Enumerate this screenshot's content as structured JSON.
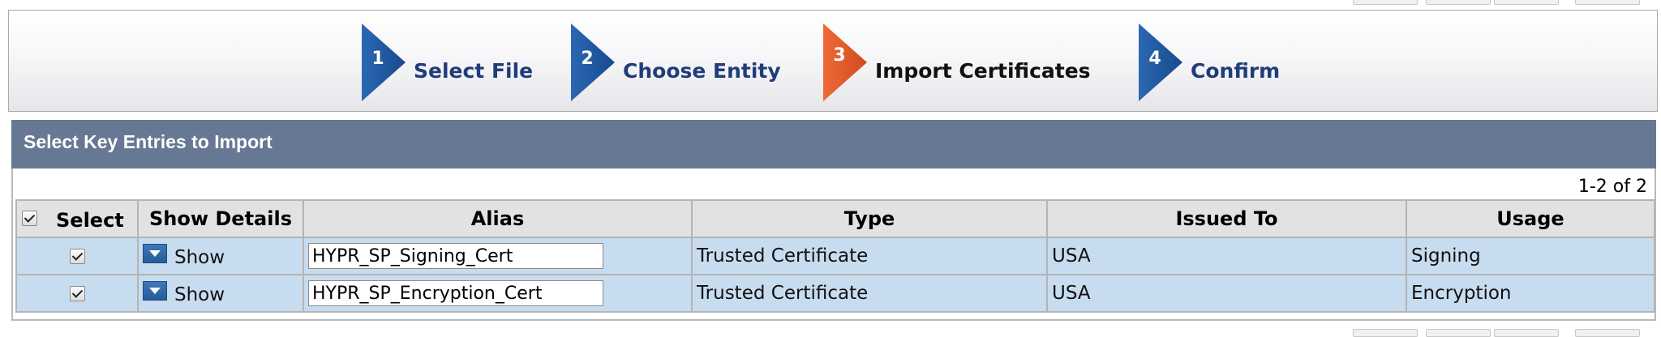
{
  "wizard": {
    "steps": [
      {
        "number": "1",
        "label": "Select File",
        "state": "complete"
      },
      {
        "number": "2",
        "label": "Choose Entity",
        "state": "complete"
      },
      {
        "number": "3",
        "label": "Import Certificates",
        "state": "active"
      },
      {
        "number": "4",
        "label": "Confirm",
        "state": "pending"
      }
    ],
    "colors": {
      "step": "#1e5aa8",
      "active": "#e0552a"
    }
  },
  "panel": {
    "title": "Select Key Entries to Import",
    "pager": "1-2 of 2"
  },
  "table": {
    "columns": {
      "select": "Select",
      "show_details": "Show Details",
      "alias": "Alias",
      "type": "Type",
      "issued_to": "Issued To",
      "usage": "Usage"
    },
    "header_checked": true,
    "rows": [
      {
        "checked": true,
        "show_label": "Show",
        "alias": "HYPR_SP_Signing_Cert",
        "type": "Trusted Certificate",
        "issued_to": "USA",
        "usage": "Signing"
      },
      {
        "checked": true,
        "show_label": "Show",
        "alias": "HYPR_SP_Encryption_Cert",
        "type": "Trusted Certificate",
        "issued_to": "USA",
        "usage": "Encryption"
      }
    ]
  }
}
